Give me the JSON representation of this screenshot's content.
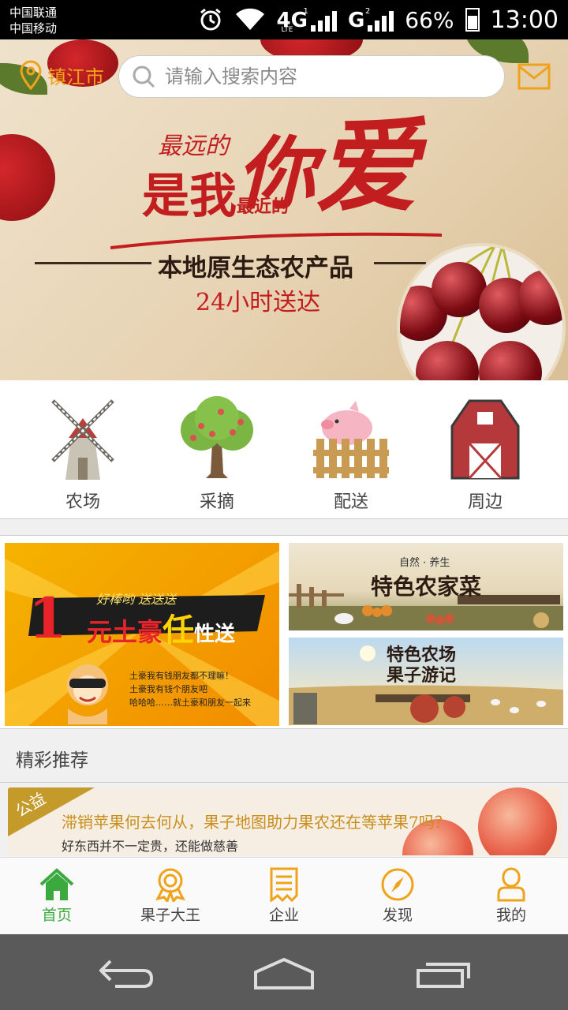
{
  "status_bar": {
    "carrier1": "中国联通",
    "carrier2": "中国移动",
    "network1": "4G",
    "network1_sub": "LTE",
    "sim1": "1",
    "network2": "G",
    "sim2": "2",
    "battery": "66%",
    "battery_level": 0.66,
    "time": "13:00"
  },
  "header": {
    "location": "镇江市",
    "search_placeholder": "请输入搜索内容"
  },
  "banner": {
    "line1": "最远的",
    "line2a": "是我",
    "line2b": "最近的",
    "line3": "你",
    "love": "爱",
    "headline": "本地原生态农产品",
    "subline": "24小时送达"
  },
  "categories": [
    {
      "label": "农场",
      "icon": "windmill-icon"
    },
    {
      "label": "采摘",
      "icon": "apple-tree-icon"
    },
    {
      "label": "配送",
      "icon": "pig-fence-icon"
    },
    {
      "label": "周边",
      "icon": "barn-icon"
    }
  ],
  "promos": {
    "left": {
      "badge": "1",
      "tagline": "好棒哟 送送送",
      "title_a": "元土豪",
      "title_b": "任",
      "title_c": "性送",
      "line1": "土豪我有钱朋友都不理嘛！",
      "line2": "土豪我有钱个朋友吧",
      "line3": "哈哈哈……就土豪和朋友一起来"
    },
    "right_top": {
      "small": "自然 · 养生",
      "title": "特色农家菜"
    },
    "right_bottom": {
      "title1": "特色农场",
      "title2": "果子游记"
    }
  },
  "section_title": "精彩推荐",
  "article": {
    "tag": "公益",
    "title": "滞销苹果何去何从，果子地图助力果农还在等苹果7吗？",
    "subtitle": "好东西并不一定贵，还能做慈善"
  },
  "nav": [
    {
      "label": "首页",
      "icon": "home-icon",
      "active": true
    },
    {
      "label": "果子大王",
      "icon": "award-icon",
      "active": false
    },
    {
      "label": "企业",
      "icon": "document-icon",
      "active": false
    },
    {
      "label": "发现",
      "icon": "compass-icon",
      "active": false
    },
    {
      "label": "我的",
      "icon": "user-icon",
      "active": false
    }
  ],
  "colors": {
    "accent_orange": "#f0a21a",
    "active_green": "#3ca93f",
    "banner_red": "#c21d1f",
    "system_bar": "#5a5a5a"
  }
}
